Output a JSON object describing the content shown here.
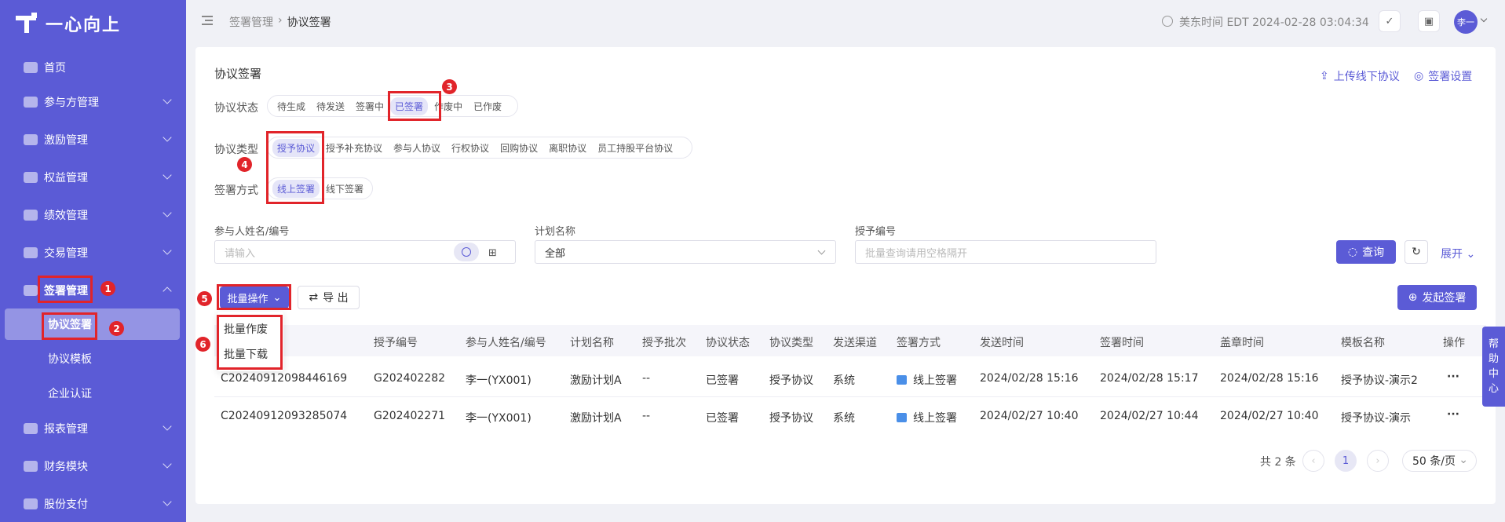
{
  "logo": {
    "text": "一心向上"
  },
  "sidebar": {
    "items": [
      {
        "label": "首页"
      },
      {
        "label": "参与方管理"
      },
      {
        "label": "激励管理"
      },
      {
        "label": "权益管理"
      },
      {
        "label": "绩效管理"
      },
      {
        "label": "交易管理"
      },
      {
        "label": "签署管理"
      },
      {
        "label": "报表管理"
      },
      {
        "label": "财务模块"
      },
      {
        "label": "股份支付"
      }
    ],
    "sub_items": [
      {
        "label": "协议签署"
      },
      {
        "label": "协议模板"
      },
      {
        "label": "企业认证"
      }
    ]
  },
  "header": {
    "breadcrumb": [
      "签署管理",
      "协议签署"
    ],
    "time": "美东时间 EDT 2024-02-28 03:04:34",
    "avatar": "李一"
  },
  "page": {
    "title": "协议签署",
    "upload_link": "上传线下协议",
    "settings_link": "签署设置"
  },
  "filters": {
    "status_label": "协议状态",
    "status_tabs": [
      "待生成",
      "待发送",
      "签署中",
      "已签署",
      "作废中",
      "已作废"
    ],
    "type_label": "协议类型",
    "type_tabs": [
      "授予协议",
      "授予补充协议",
      "参与人协议",
      "行权协议",
      "回购协议",
      "离职协议",
      "员工持股平台协议"
    ],
    "method_label": "签署方式",
    "method_tabs": [
      "线上签署",
      "线下签署"
    ],
    "participant_label": "参与人姓名/编号",
    "participant_placeholder": "请输入",
    "plan_label": "计划名称",
    "plan_value": "全部",
    "grant_label": "授予编号",
    "grant_placeholder": "批量查询请用空格隔开",
    "query_btn": "查询",
    "expand": "展开"
  },
  "toolbar": {
    "batch_btn": "批量操作",
    "export_btn": "导 出",
    "launch_btn": "发起签署"
  },
  "dropdown": [
    "批量作废",
    "批量下载"
  ],
  "table": {
    "headers": [
      "授予编号",
      "参与人姓名/编号",
      "计划名称",
      "授予批次",
      "协议状态",
      "协议类型",
      "发送渠道",
      "签署方式",
      "发送时间",
      "签署时间",
      "盖章时间",
      "模板名称",
      "操作"
    ],
    "rows": [
      [
        "C20240912098446169",
        "G202402282",
        "李一(YX001)",
        "激励计划A",
        "--",
        "已签署",
        "授予协议",
        "系统",
        "线上签署",
        "2024/02/28 15:16",
        "2024/02/28 15:17",
        "2024/02/28 15:16",
        "授予协议-演示2",
        "···"
      ],
      [
        "C20240912093285074",
        "G202402271",
        "李一(YX001)",
        "激励计划A",
        "--",
        "已签署",
        "授予协议",
        "系统",
        "线上签署",
        "2024/02/27 10:40",
        "2024/02/27 10:44",
        "2024/02/27 10:40",
        "授予协议-演示",
        "···"
      ]
    ]
  },
  "pagination": {
    "total": "共 2 条",
    "current": "1",
    "page_size": "50 条/页"
  },
  "help": [
    "帮",
    "助",
    "中",
    "心"
  ],
  "annotations": [
    "1",
    "2",
    "3",
    "4",
    "5",
    "6"
  ]
}
